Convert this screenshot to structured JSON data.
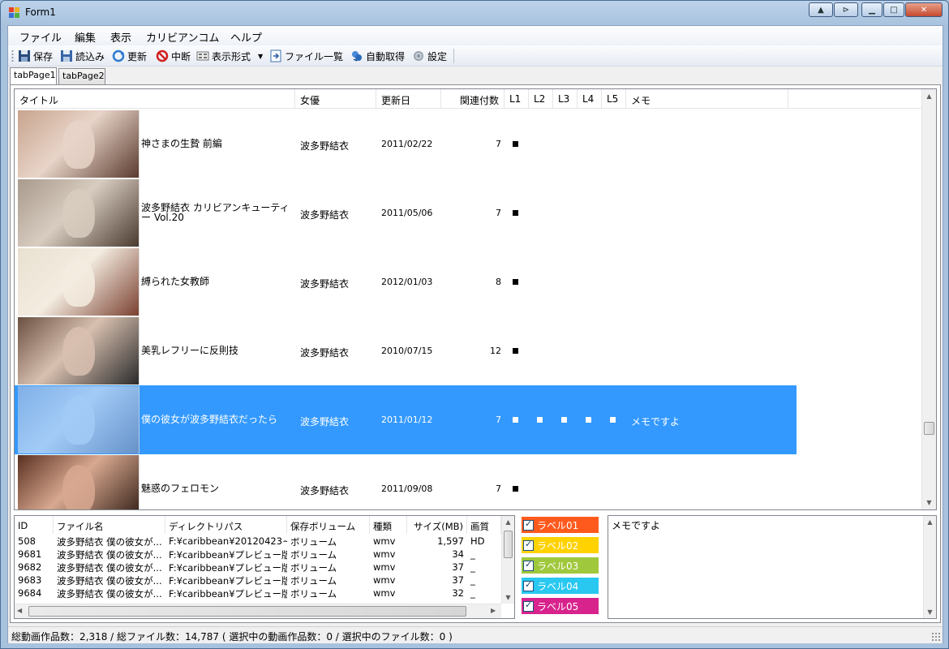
{
  "window": {
    "title": "Form1"
  },
  "menu": [
    "ファイル",
    "編集",
    "表示",
    "カリビアンコム",
    "ヘルプ"
  ],
  "toolbar": {
    "save": "保存",
    "load": "読込み",
    "refresh": "更新",
    "stop": "中断",
    "view_format": "表示形式",
    "file_list": "ファイル一覧",
    "auto_fetch": "自動取得",
    "settings": "設定"
  },
  "tabs": [
    "tabPage1",
    "tabPage2"
  ],
  "list": {
    "columns": [
      "タイトル",
      "女優",
      "更新日",
      "関連付数",
      "L1",
      "L2",
      "L3",
      "L4",
      "L5",
      "メモ"
    ],
    "rows": [
      {
        "title": "神さまの生贄 前編",
        "actress": "波多野結衣",
        "date": "2011/02/22",
        "count": "7",
        "labels": [
          1,
          0,
          0,
          0,
          0
        ],
        "memo": "",
        "selected": false,
        "thumb": [
          "#c8a48e",
          "#e8d4c8",
          "#5a3a2e"
        ]
      },
      {
        "title": "波多野結衣 カリビアンキューティー Vol.20",
        "actress": "波多野結衣",
        "date": "2011/05/06",
        "count": "7",
        "labels": [
          1,
          0,
          0,
          0,
          0
        ],
        "memo": "",
        "selected": false,
        "thumb": [
          "#a89a8c",
          "#d8ccc0",
          "#4a3a30"
        ]
      },
      {
        "title": "縛られた女教師",
        "actress": "波多野結衣",
        "date": "2012/01/03",
        "count": "8",
        "labels": [
          1,
          0,
          0,
          0,
          0
        ],
        "memo": "",
        "selected": false,
        "thumb": [
          "#e8e0d0",
          "#f4ece0",
          "#7a4030"
        ]
      },
      {
        "title": "美乳レフリーに反則技",
        "actress": "波多野結衣",
        "date": "2010/07/15",
        "count": "12",
        "labels": [
          1,
          0,
          0,
          0,
          0
        ],
        "memo": "",
        "selected": false,
        "thumb": [
          "#6a5040",
          "#d8c0b0",
          "#2a2a2a"
        ]
      },
      {
        "title": "僕の彼女が波多野結衣だったら",
        "actress": "波多野結衣",
        "date": "2011/01/12",
        "count": "7",
        "labels": [
          1,
          1,
          1,
          1,
          1
        ],
        "memo": "メモですよ",
        "selected": true,
        "thumb": [
          "#9ab8e0",
          "#c8dcf4",
          "#7890b8"
        ]
      },
      {
        "title": "魅惑のフェロモン",
        "actress": "波多野結衣",
        "date": "2011/09/08",
        "count": "7",
        "labels": [
          1,
          0,
          0,
          0,
          0
        ],
        "memo": "",
        "selected": false,
        "thumb": [
          "#5a3020",
          "#d8a890",
          "#2a1810"
        ]
      }
    ]
  },
  "files": {
    "columns": [
      "ID",
      "ファイル名",
      "ディレクトリパス",
      "保存ボリューム",
      "種類",
      "サイズ(MB)",
      "画質"
    ],
    "rows": [
      [
        "508",
        "波多野結衣 僕の彼女が...",
        "F:¥caribbean¥20120423~...",
        "ボリューム",
        "wmv",
        "1,597",
        "HD"
      ],
      [
        "9681",
        "波多野結衣 僕の彼女が...",
        "F:¥caribbean¥プレビュー版",
        "ボリューム",
        "wmv",
        "34",
        "_"
      ],
      [
        "9682",
        "波多野結衣 僕の彼女が...",
        "F:¥caribbean¥プレビュー版",
        "ボリューム",
        "wmv",
        "37",
        "_"
      ],
      [
        "9683",
        "波多野結衣 僕の彼女が...",
        "F:¥caribbean¥プレビュー版",
        "ボリューム",
        "wmv",
        "37",
        "_"
      ],
      [
        "9684",
        "波多野結衣 僕の彼女が...",
        "F:¥caribbean¥プレビュー版",
        "ボリューム",
        "wmv",
        "32",
        "_"
      ]
    ]
  },
  "labels": [
    {
      "name": "ラベル01",
      "color": "#ff5a1e",
      "checked": true
    },
    {
      "name": "ラベル02",
      "color": "#ffd200",
      "checked": true
    },
    {
      "name": "ラベル03",
      "color": "#a0c83c",
      "checked": true
    },
    {
      "name": "ラベル04",
      "color": "#28c8f0",
      "checked": true
    },
    {
      "name": "ラベル05",
      "color": "#d8238c",
      "checked": true
    }
  ],
  "memo": "メモですよ",
  "status": "総動画作品数：2,318 / 総ファイル数：14,787 ( 選択中の動画作品数：0 / 選択中のファイル数：0 )",
  "colors": {
    "selection": "#3399ff"
  }
}
